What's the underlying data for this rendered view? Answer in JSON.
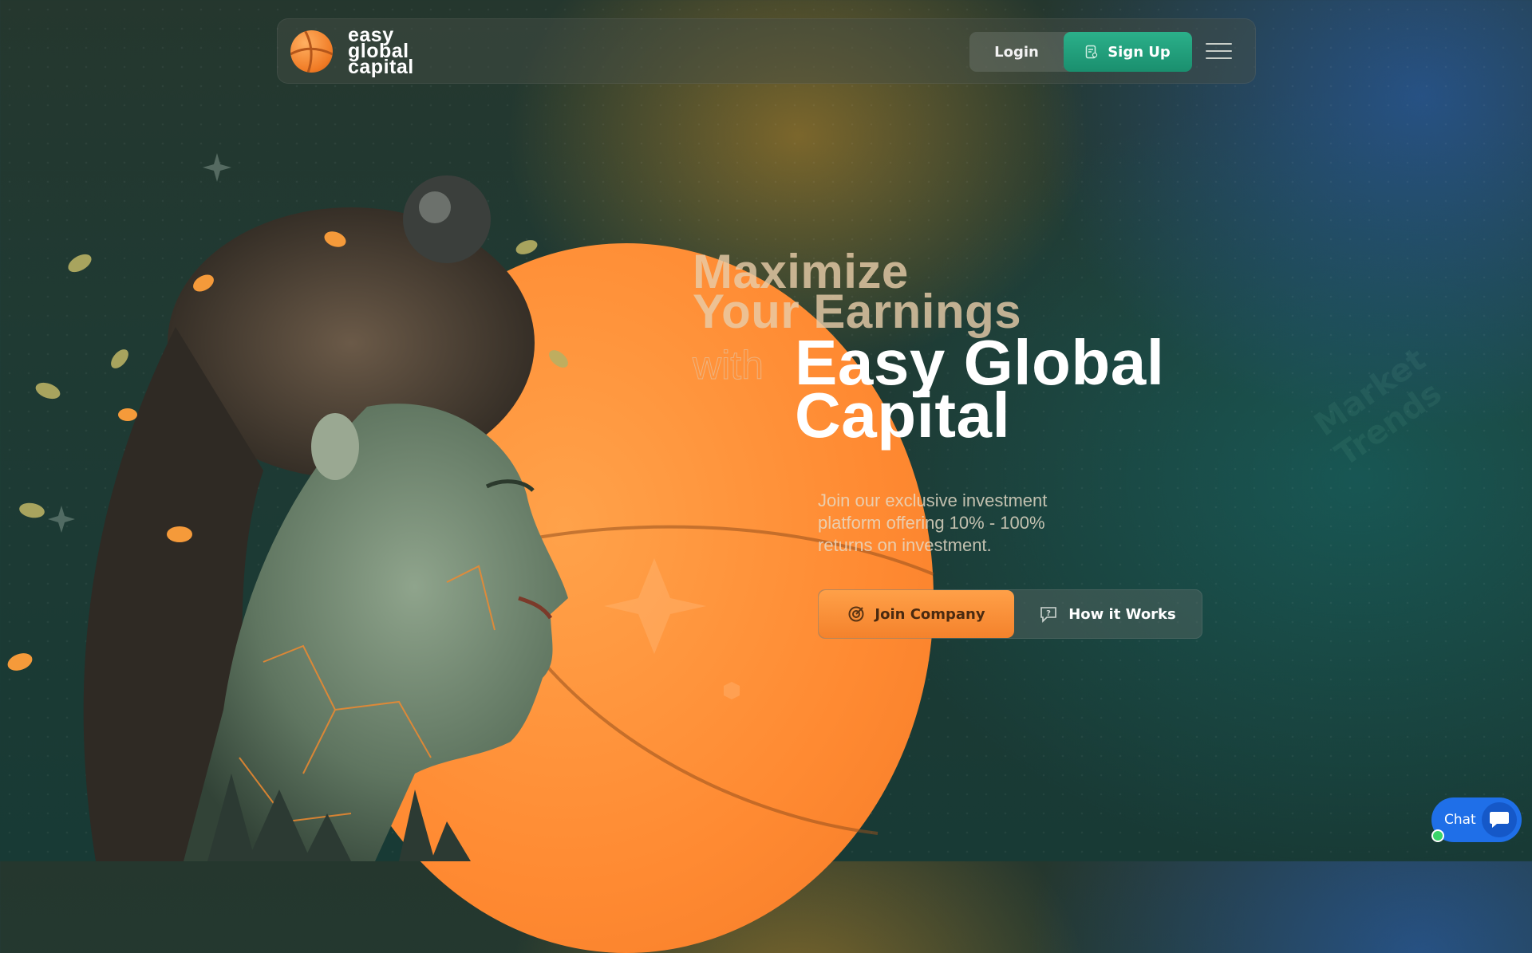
{
  "colors": {
    "accent_orange": "#ff8a32",
    "accent_green": "#1f9f7c",
    "chat_blue": "#1f6fe8",
    "background": "#1f3a33"
  },
  "header": {
    "logo": {
      "icon": "orange-ball-icon",
      "line1": "easy",
      "line2": "global",
      "line3": "capital"
    },
    "login_label": "Login",
    "signup_label": "Sign Up",
    "signup_icon": "document-user-icon",
    "menu_icon": "hamburger-menu-icon"
  },
  "hero": {
    "line1": "Maximize",
    "line2": "Your Earnings",
    "with": "with",
    "brand_line1": "Easy Global",
    "brand_line2": "Capital",
    "subtitle": "Join our exclusive investment platform offering 10% - 100% returns on investment.",
    "join_label": "Join Company",
    "join_icon": "target-icon",
    "how_label": "How it Works",
    "how_icon": "help-chat-icon"
  },
  "chat": {
    "label": "Chat",
    "icon": "chat-bubble-icon",
    "status": "online"
  }
}
